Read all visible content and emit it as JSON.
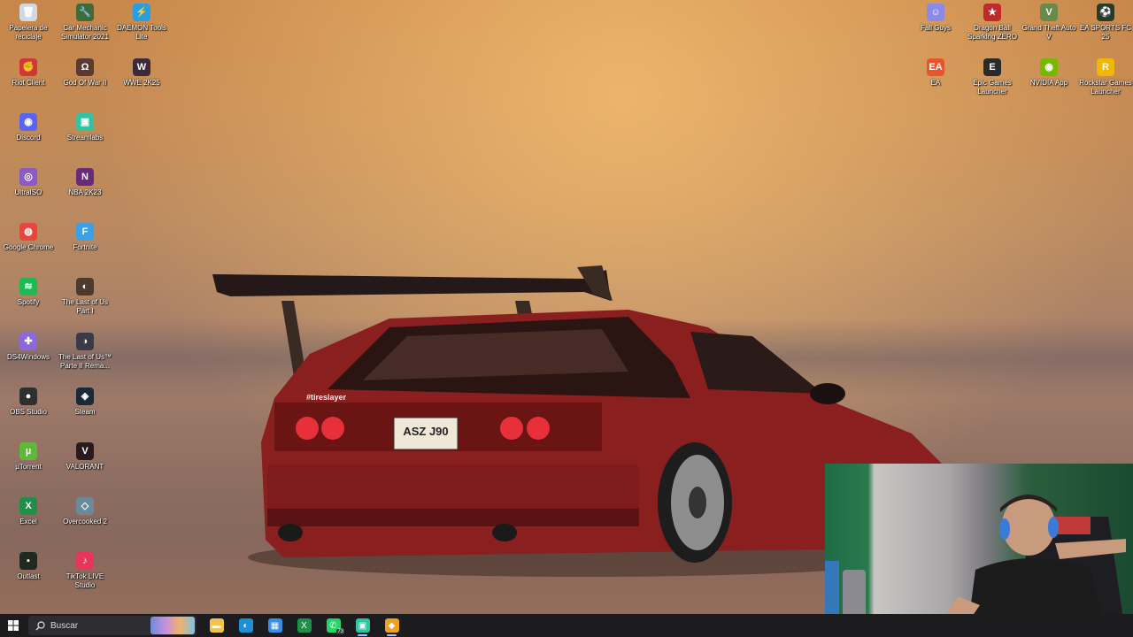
{
  "desktop": {
    "left_icons": [
      {
        "label": "Papelera de reciclaje",
        "icon": "recycle-bin-icon",
        "color": "#cfd8e3",
        "glyph": "🗑"
      },
      {
        "label": "Car Mechanic Simulator 2021",
        "icon": "car-mechanic-icon",
        "color": "#3e6b3a",
        "glyph": "🔧"
      },
      {
        "label": "DAEMON Tools Lite",
        "icon": "daemon-tools-icon",
        "color": "#2a9fe0",
        "glyph": "⚡"
      },
      {
        "label": "Riot Client",
        "icon": "riot-client-icon",
        "color": "#d13639",
        "glyph": "✊"
      },
      {
        "label": "God Of War II",
        "icon": "god-of-war-icon",
        "color": "#5a3a32",
        "glyph": "Ω"
      },
      {
        "label": "WWE 2K25",
        "icon": "wwe-icon",
        "color": "#3a2a3a",
        "glyph": "W"
      },
      {
        "label": "Discord",
        "icon": "discord-icon",
        "color": "#5865f2",
        "glyph": "◉"
      },
      {
        "label": "Streamlabs",
        "icon": "streamlabs-icon",
        "color": "#31c3a2",
        "glyph": "▣"
      },
      {
        "label": "UltraISO",
        "icon": "ultraiso-icon",
        "color": "#8a5ac8",
        "glyph": "◎"
      },
      {
        "label": "NBA 2K23",
        "icon": "nba-icon",
        "color": "#6a2a7a",
        "glyph": "N"
      },
      {
        "label": "Google Chrome",
        "icon": "chrome-icon",
        "color": "#e8463a",
        "glyph": "◍"
      },
      {
        "label": "Fortnite",
        "icon": "fortnite-icon",
        "color": "#3aa0e8",
        "glyph": "F"
      },
      {
        "label": "Spotify",
        "icon": "spotify-icon",
        "color": "#1db954",
        "glyph": "≋"
      },
      {
        "label": "The Last of Us Part I",
        "icon": "last-of-us-icon",
        "color": "#4a3a30",
        "glyph": "◐"
      },
      {
        "label": "DS4Windows",
        "icon": "ds4windows-icon",
        "color": "#8a6ad8",
        "glyph": "✚"
      },
      {
        "label": "The Last of Us™ Parte II Rema...",
        "icon": "last-of-us-2-icon",
        "color": "#3a3a48",
        "glyph": "◑"
      },
      {
        "label": "OBS Studio",
        "icon": "obs-icon",
        "color": "#302e31",
        "glyph": "●"
      },
      {
        "label": "Steam",
        "icon": "steam-icon",
        "color": "#1b2838",
        "glyph": "◈"
      },
      {
        "label": "µTorrent",
        "icon": "utorrent-icon",
        "color": "#5fb83a",
        "glyph": "µ"
      },
      {
        "label": "VALORANT",
        "icon": "valorant-icon",
        "color": "#2a1a1e",
        "glyph": "V"
      },
      {
        "label": "Excel",
        "icon": "excel-icon",
        "color": "#1f8f4a",
        "glyph": "X"
      },
      {
        "label": "Overcooked 2",
        "icon": "overcooked-icon",
        "color": "#6a8a9a",
        "glyph": "◇"
      },
      {
        "label": "Outlast",
        "icon": "outlast-icon",
        "color": "#1f2a22",
        "glyph": "▪"
      },
      {
        "label": "TikTok LIVE Studio",
        "icon": "tiktok-live-icon",
        "color": "#e8365a",
        "glyph": "♪"
      }
    ],
    "right_icons": [
      {
        "label": "Fall Guys",
        "icon": "fall-guys-icon",
        "color": "#8a8ae8",
        "glyph": "☺"
      },
      {
        "label": "Dragon Ball Sparking ZERO",
        "icon": "dragon-ball-icon",
        "color": "#c02a2a",
        "glyph": "★"
      },
      {
        "label": "Grand Theft Auto V",
        "icon": "gta-icon",
        "color": "#6a8a4a",
        "glyph": "V"
      },
      {
        "label": "EA SPORTS FC 25",
        "icon": "ea-fc-icon",
        "color": "#2a3a2a",
        "glyph": "⚽"
      },
      {
        "label": "EA",
        "icon": "ea-icon",
        "color": "#e8552a",
        "glyph": "EA"
      },
      {
        "label": "Epic Games Launcher",
        "icon": "epic-games-icon",
        "color": "#2a2a2a",
        "glyph": "E"
      },
      {
        "label": "NVIDIA App",
        "icon": "nvidia-icon",
        "color": "#76b900",
        "glyph": "◉"
      },
      {
        "label": "Rockstar Games Launcher",
        "icon": "rockstar-icon",
        "color": "#f0b800",
        "glyph": "R"
      }
    ]
  },
  "taskbar": {
    "search_placeholder": "Buscar",
    "apps": [
      {
        "icon": "file-explorer-icon",
        "color": "#f2c14e",
        "glyph": "▬",
        "badge": "",
        "active": false
      },
      {
        "icon": "edge-icon",
        "color": "#1e8fd6",
        "glyph": "◐",
        "badge": "",
        "active": false
      },
      {
        "icon": "microsoft-store-icon",
        "color": "#3a8ee6",
        "glyph": "▦",
        "badge": "",
        "active": false
      },
      {
        "icon": "excel-taskbar-icon",
        "color": "#1f8f4a",
        "glyph": "X",
        "badge": "",
        "active": false
      },
      {
        "icon": "whatsapp-icon",
        "color": "#25d366",
        "glyph": "✆",
        "badge": "73",
        "active": false
      },
      {
        "icon": "streamlabs-taskbar-icon",
        "color": "#31c3a2",
        "glyph": "▣",
        "badge": "",
        "active": true
      },
      {
        "icon": "app-taskbar-icon",
        "color": "#f0a020",
        "glyph": "◆",
        "badge": "",
        "active": true
      }
    ]
  },
  "wallpaper": {
    "plate_text": "ASZ J90",
    "sticker_text": "#tireslayer"
  }
}
